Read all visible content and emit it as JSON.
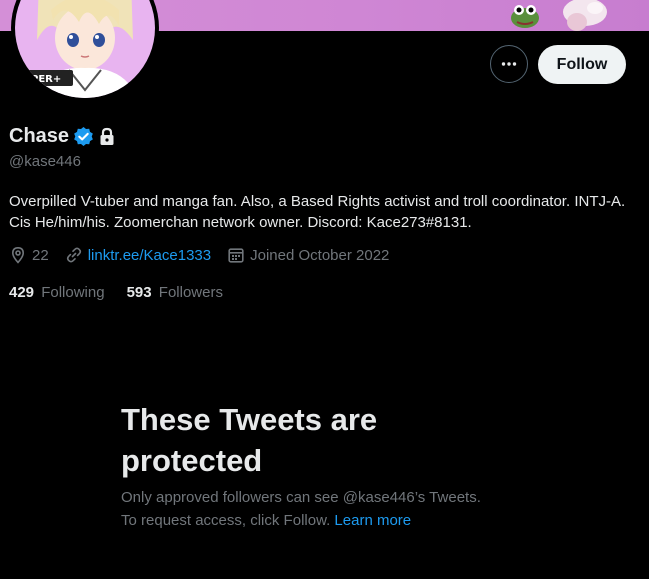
{
  "profile": {
    "display_name": "Chase",
    "handle": "@kase446",
    "bio": "Overpilled V-tuber and manga fan. Also, a Based Rights activist and troll coordinator. INTJ-A. Cis He/him/his. Zoomerchan network owner. Discord: Kace273#8131.",
    "location": "22",
    "website": "linktr.ee/Kace1333",
    "joined": "Joined October 2022",
    "following_count": "429",
    "following_label": "Following",
    "followers_count": "593",
    "followers_label": "Followers",
    "avatar_text": "PER+"
  },
  "actions": {
    "more_label": "•••",
    "follow_label": "Follow"
  },
  "protected": {
    "title": "These Tweets are protected",
    "line1": "Only approved followers can see @kase446’s Tweets.",
    "line2": "To request access, click Follow.",
    "learn_more": "Learn more"
  },
  "colors": {
    "background": "#000000",
    "accent": "#1d9bf0",
    "banner": "#cf86d4",
    "secondary_text": "#71767b",
    "primary_text": "#e7e9ea"
  },
  "icons": {
    "verified": "verified-badge-icon",
    "protected": "lock-icon",
    "location": "location-pin-icon",
    "link": "link-icon",
    "calendar": "calendar-icon",
    "more": "more-horizontal-icon"
  }
}
